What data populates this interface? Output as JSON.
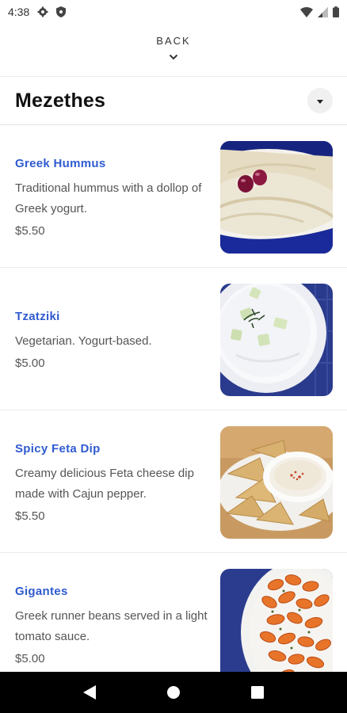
{
  "status_bar": {
    "time": "4:38",
    "icons_left": [
      "gear-icon",
      "shield-icon"
    ],
    "icons_right": [
      "wifi-icon",
      "signal-icon",
      "battery-icon"
    ]
  },
  "header": {
    "back_label": "BACK",
    "back_icon": "chevron-down-icon"
  },
  "category": {
    "title": "Mezethes",
    "dropdown_icon": "caret-down-icon"
  },
  "items": [
    {
      "name": "Greek Hummus",
      "description": "Traditional hummus with a dollop of Greek yogurt.",
      "price": "$5.50",
      "photo": "hummus-photo"
    },
    {
      "name": "Tzatziki",
      "description": "Vegetarian. Yogurt-based.",
      "price": "$5.00",
      "photo": "tzatziki-photo"
    },
    {
      "name": "Spicy Feta Dip",
      "description": "Creamy delicious Feta cheese dip made with Cajun pepper.",
      "price": "$5.50",
      "photo": "feta-dip-photo"
    },
    {
      "name": "Gigantes",
      "description": "Greek runner beans served in a light tomato sauce.",
      "price": "$5.00",
      "photo": "gigantes-photo"
    }
  ],
  "nav_bar": {
    "icons": [
      "back-triangle-icon",
      "home-circle-icon",
      "recents-square-icon"
    ]
  }
}
